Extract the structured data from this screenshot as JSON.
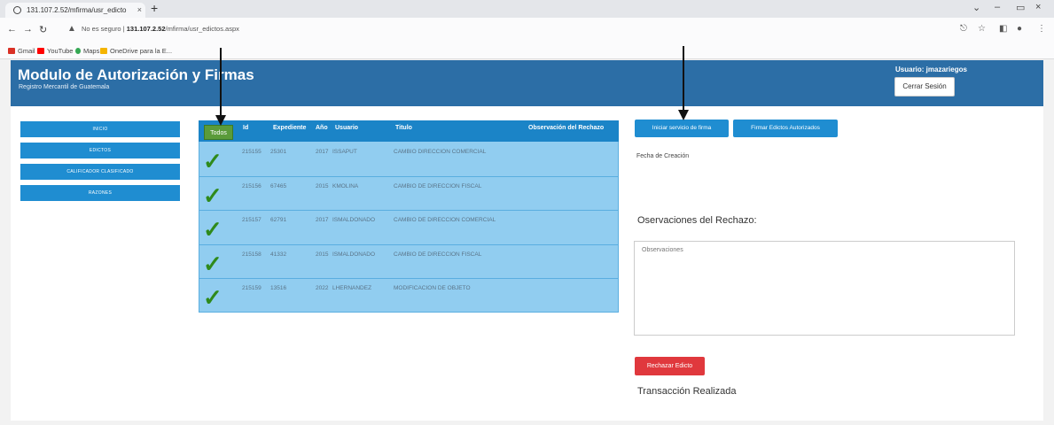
{
  "browser": {
    "tab_title": "131.107.2.52/mfirma/usr_edicto",
    "tab_close": "×",
    "new_tab": "+",
    "warn_text": "No es seguro",
    "url_host": "131.107.2.52",
    "url_path": "/mfirma/usr_edictos.aspx",
    "bookmarks": [
      "Gmail",
      "YouTube",
      "Maps",
      "OneDrive para la E..."
    ]
  },
  "app": {
    "title": "Modulo de Autorización y Firmas",
    "subtitle": "Registro Mercantil de Guatemala",
    "user_label": "Usuario: jmazariegos",
    "logout_label": "Cerrar Sesión"
  },
  "sidebar": {
    "items": [
      "Inicio",
      "Edictos",
      "Calificador Clasificado",
      "Razones"
    ]
  },
  "table": {
    "select_all_label": "Todos",
    "headers": {
      "id": "Id",
      "expediente": "Expediente",
      "anio": "Año",
      "usuario": "Usuario",
      "titulo": "Titulo",
      "observacion": "Observación del Rechazo"
    },
    "rows": [
      {
        "id": "215155",
        "expediente": "25301",
        "anio": "2017",
        "usuario": "ISSAPUT",
        "titulo": "CAMBIO DIRECCION COMERCIAL"
      },
      {
        "id": "215156",
        "expediente": "67465",
        "anio": "2015",
        "usuario": "KMOLINA",
        "titulo": "CAMBIO DE DIRECCION FISCAL"
      },
      {
        "id": "215157",
        "expediente": "62791",
        "anio": "2017",
        "usuario": "ISMALDONADO",
        "titulo": "CAMBIO DE DIRECCION COMERCIAL"
      },
      {
        "id": "215158",
        "expediente": "41332",
        "anio": "2015",
        "usuario": "ISMALDONADO",
        "titulo": "CAMBIO DE DIRECCION FISCAL"
      },
      {
        "id": "215159",
        "expediente": "13516",
        "anio": "2022",
        "usuario": "LHERNANDEZ",
        "titulo": "MODIFICACION DE OBJETO"
      }
    ],
    "check_glyph": "✓"
  },
  "panel": {
    "start_service_label": "Iniciar servicio de firma",
    "sign_label": "Firmar Edictos Autorizados",
    "fecha_label": "Fecha de Creación",
    "obs_title": "Oservaciones del Rechazo:",
    "obs_placeholder": "Observaciones",
    "reject_label": "Rechazar Edicto",
    "status_text": "Transacción Realizada"
  },
  "colors": {
    "header_bg": "#2c6ea6",
    "button_blue": "#1f8dd1",
    "table_bg": "#91cdf0",
    "todos_green": "#5a9b3a",
    "reject_red": "#e0383d",
    "check_green": "#2f8a1b"
  }
}
